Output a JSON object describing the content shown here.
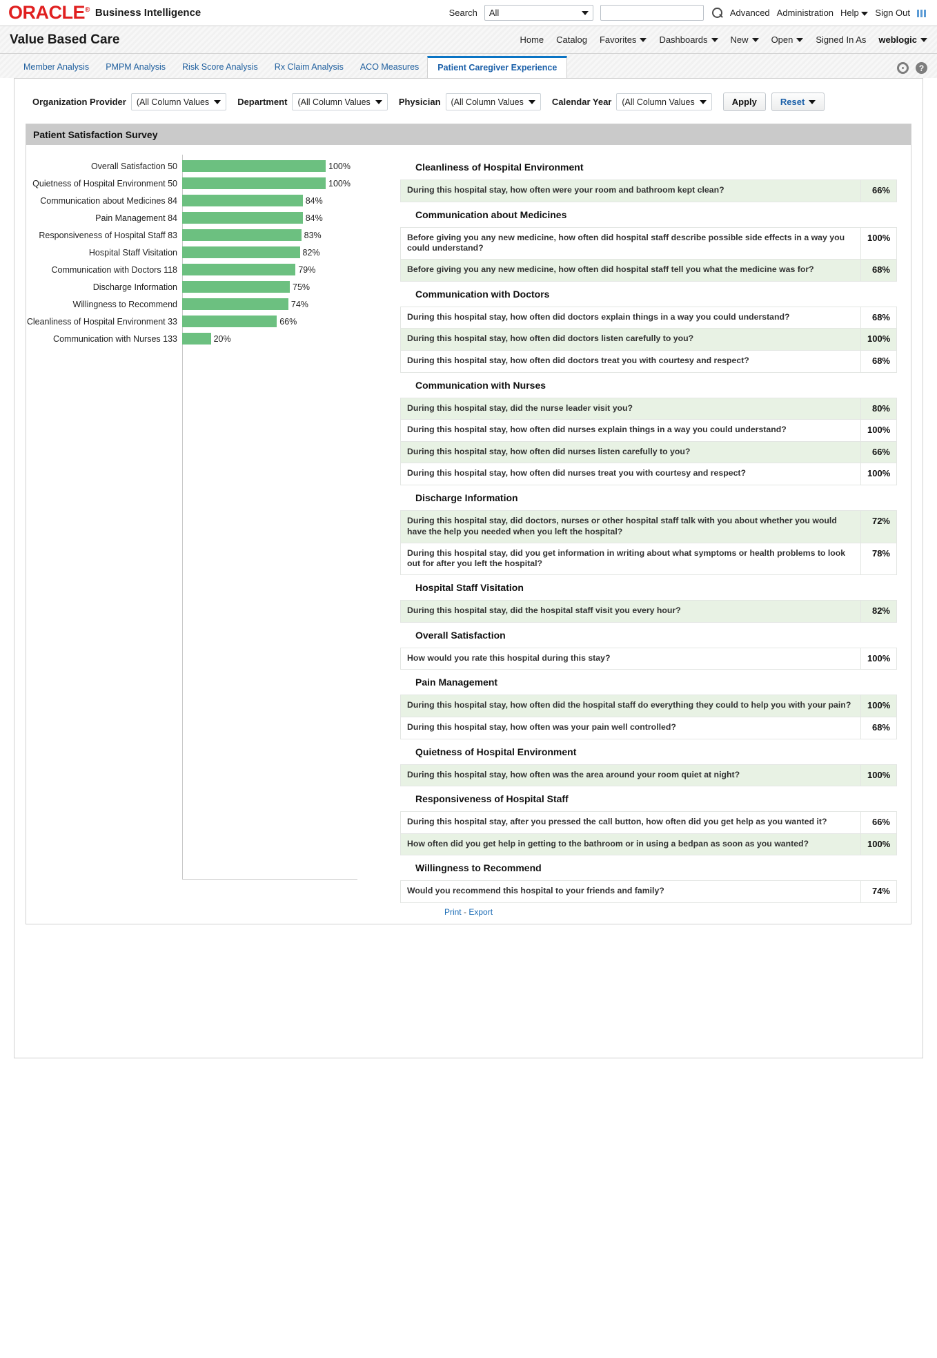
{
  "header": {
    "logo": "ORACLE",
    "logo_reg": "®",
    "product": "Business Intelligence",
    "search_label": "Search",
    "search_scope": "All",
    "search_value": "",
    "search_placeholder": "",
    "links": [
      "Advanced",
      "Administration"
    ],
    "help": "Help",
    "sign_out": "Sign Out"
  },
  "dashboard": {
    "title": "Value Based Care",
    "nav": [
      {
        "label": "Home",
        "caret": false
      },
      {
        "label": "Catalog",
        "caret": false
      },
      {
        "label": "Favorites",
        "caret": true
      },
      {
        "label": "Dashboards",
        "caret": true
      },
      {
        "label": "New",
        "caret": true
      },
      {
        "label": "Open",
        "caret": true
      }
    ],
    "signed_in_as_label": "Signed In As",
    "user": "weblogic"
  },
  "tabs": [
    {
      "label": "Member Analysis",
      "active": false
    },
    {
      "label": "PMPM Analysis",
      "active": false
    },
    {
      "label": "Risk Score Analysis",
      "active": false
    },
    {
      "label": "Rx Claim Analysis",
      "active": false
    },
    {
      "label": "ACO Measures",
      "active": false
    },
    {
      "label": "Patient Caregiver Experience",
      "active": true
    }
  ],
  "prompts": {
    "filters": [
      {
        "label": "Organization Provider",
        "value": "(All Column Values"
      },
      {
        "label": "Department",
        "value": "(All Column Values"
      },
      {
        "label": "Physician",
        "value": "(All Column Values"
      },
      {
        "label": "Calendar Year",
        "value": "(All Column Values"
      }
    ],
    "apply": "Apply",
    "reset": "Reset"
  },
  "report": {
    "title": "Patient Satisfaction Survey",
    "print": "Print",
    "separator": "-",
    "export": "Export"
  },
  "chart_data": {
    "type": "bar",
    "title": "Patient Satisfaction Survey",
    "orientation": "horizontal",
    "xlabel": "",
    "ylabel": "",
    "xlim": [
      0,
      100
    ],
    "grid": false,
    "legend": "none",
    "categories": [
      "Overall Satisfaction 50",
      "Quietness of Hospital Environment 50",
      "Communication about Medicines 84",
      "Pain Management 84",
      "Responsiveness of Hospital Staff 83",
      "Hospital Staff Visitation",
      "Communication with Doctors 118",
      "Discharge Information",
      "Willingness to Recommend",
      "Cleanliness of Hospital Environment 33",
      "Communication with Nurses 133"
    ],
    "values": [
      100,
      100,
      84,
      84,
      83,
      82,
      79,
      75,
      74,
      66,
      20
    ],
    "value_labels": [
      "100%",
      "100%",
      "84%",
      "84%",
      "83%",
      "82%",
      "79%",
      "75%",
      "74%",
      "66%",
      "20%"
    ],
    "bar_color": "#6cc080"
  },
  "survey": {
    "groups": [
      {
        "title": "Cleanliness of Hospital Environment",
        "rows": [
          {
            "question": "During this hospital stay, how often were your room and bathroom kept clean?",
            "value": "66%",
            "alt": true
          }
        ]
      },
      {
        "title": "Communication about Medicines",
        "rows": [
          {
            "question": "Before giving you any new medicine, how often did hospital staff describe possible side effects in a way you could understand?",
            "value": "100%",
            "alt": false
          },
          {
            "question": "Before giving you any new medicine, how often did hospital staff tell you what the medicine was for?",
            "value": "68%",
            "alt": true
          }
        ]
      },
      {
        "title": "Communication with Doctors",
        "rows": [
          {
            "question": "During this hospital stay, how often did doctors explain things in a way you could understand?",
            "value": "68%",
            "alt": false
          },
          {
            "question": "During this hospital stay, how often did doctors listen carefully to you?",
            "value": "100%",
            "alt": true
          },
          {
            "question": "During this hospital stay, how often did doctors treat you with courtesy and respect?",
            "value": "68%",
            "alt": false
          }
        ]
      },
      {
        "title": "Communication with Nurses",
        "rows": [
          {
            "question": "During this hospital stay, did the nurse leader visit you?",
            "value": "80%",
            "alt": true
          },
          {
            "question": "During this hospital stay, how often did nurses explain things in a way you could understand?",
            "value": "100%",
            "alt": false
          },
          {
            "question": "During this hospital stay, how often did nurses listen carefully to you?",
            "value": "66%",
            "alt": true
          },
          {
            "question": "During this hospital stay, how often did nurses treat you with courtesy and respect?",
            "value": "100%",
            "alt": false
          }
        ]
      },
      {
        "title": "Discharge Information",
        "rows": [
          {
            "question": "During this hospital stay, did doctors, nurses or other hospital staff talk with you about whether you would have the help you needed when you left the hospital?",
            "value": "72%",
            "alt": true
          },
          {
            "question": "During this hospital stay, did you get information in writing about what symptoms or health problems to look out for after you left the hospital?",
            "value": "78%",
            "alt": false
          }
        ]
      },
      {
        "title": "Hospital Staff Visitation",
        "rows": [
          {
            "question": "During this hospital stay, did the hospital staff visit you every hour?",
            "value": "82%",
            "alt": true
          }
        ]
      },
      {
        "title": "Overall Satisfaction",
        "rows": [
          {
            "question": "How would you rate this hospital during this stay?",
            "value": "100%",
            "alt": false
          }
        ]
      },
      {
        "title": "Pain Management",
        "rows": [
          {
            "question": "During this hospital stay, how often did the hospital staff do everything they could to help you with your pain?",
            "value": "100%",
            "alt": true
          },
          {
            "question": "During this hospital stay, how often was your pain well controlled?",
            "value": "68%",
            "alt": false
          }
        ]
      },
      {
        "title": "Quietness of Hospital Environment",
        "rows": [
          {
            "question": "During this hospital stay, how often was the area around your room quiet at night?",
            "value": "100%",
            "alt": true
          }
        ]
      },
      {
        "title": "Responsiveness of Hospital Staff",
        "rows": [
          {
            "question": "During this hospital stay, after you pressed the call button, how often did you get help as you wanted it?",
            "value": "66%",
            "alt": false
          },
          {
            "question": "How often did you get help in getting to the bathroom or in using a bedpan as soon as you wanted?",
            "value": "100%",
            "alt": true
          }
        ]
      },
      {
        "title": "Willingness to Recommend",
        "rows": [
          {
            "question": "Would you recommend this hospital to your friends and family?",
            "value": "74%",
            "alt": false
          }
        ]
      }
    ]
  }
}
